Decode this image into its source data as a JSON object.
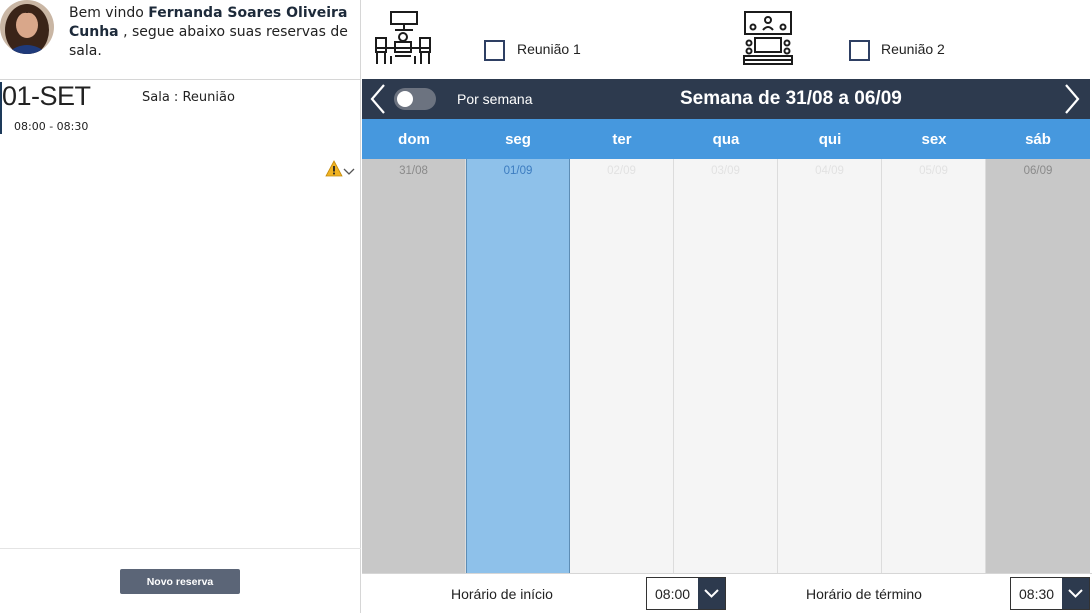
{
  "welcome": {
    "prefix": "Bem vindo ",
    "user_name": "Fernanda Soares Oliveira Cunha",
    "suffix": " , segue abaixo suas reservas de sala."
  },
  "reservation": {
    "date": "01-SET",
    "room": "Sala : Reunião",
    "time": "08:00 - 08:30"
  },
  "new_button": "Novo reserva",
  "rooms": [
    {
      "label": "Reunião 1",
      "icon": "meeting-table-icon",
      "checked": false
    },
    {
      "label": "Reunião 2",
      "icon": "conference-room-icon",
      "checked": false
    }
  ],
  "week": {
    "toggle_label": "Por semana",
    "title": "Semana de 31/08 a 06/09"
  },
  "days": [
    {
      "name": "dom",
      "date": "31/08",
      "state": "weekend"
    },
    {
      "name": "seg",
      "date": "01/09",
      "state": "selected"
    },
    {
      "name": "ter",
      "date": "02/09",
      "state": "normal"
    },
    {
      "name": "qua",
      "date": "03/09",
      "state": "normal"
    },
    {
      "name": "qui",
      "date": "04/09",
      "state": "normal"
    },
    {
      "name": "sex",
      "date": "05/09",
      "state": "normal"
    },
    {
      "name": "sáb",
      "date": "06/09",
      "state": "weekend"
    }
  ],
  "bottom": {
    "start_label": "Horário de início",
    "start_value": "08:00",
    "end_label": "Horário de término",
    "end_value": "08:30"
  },
  "colors": {
    "header_dark": "#2d3a4e",
    "day_header": "#4698de",
    "selected_day": "#8ec1ea",
    "weekend": "#c8c8c8"
  }
}
